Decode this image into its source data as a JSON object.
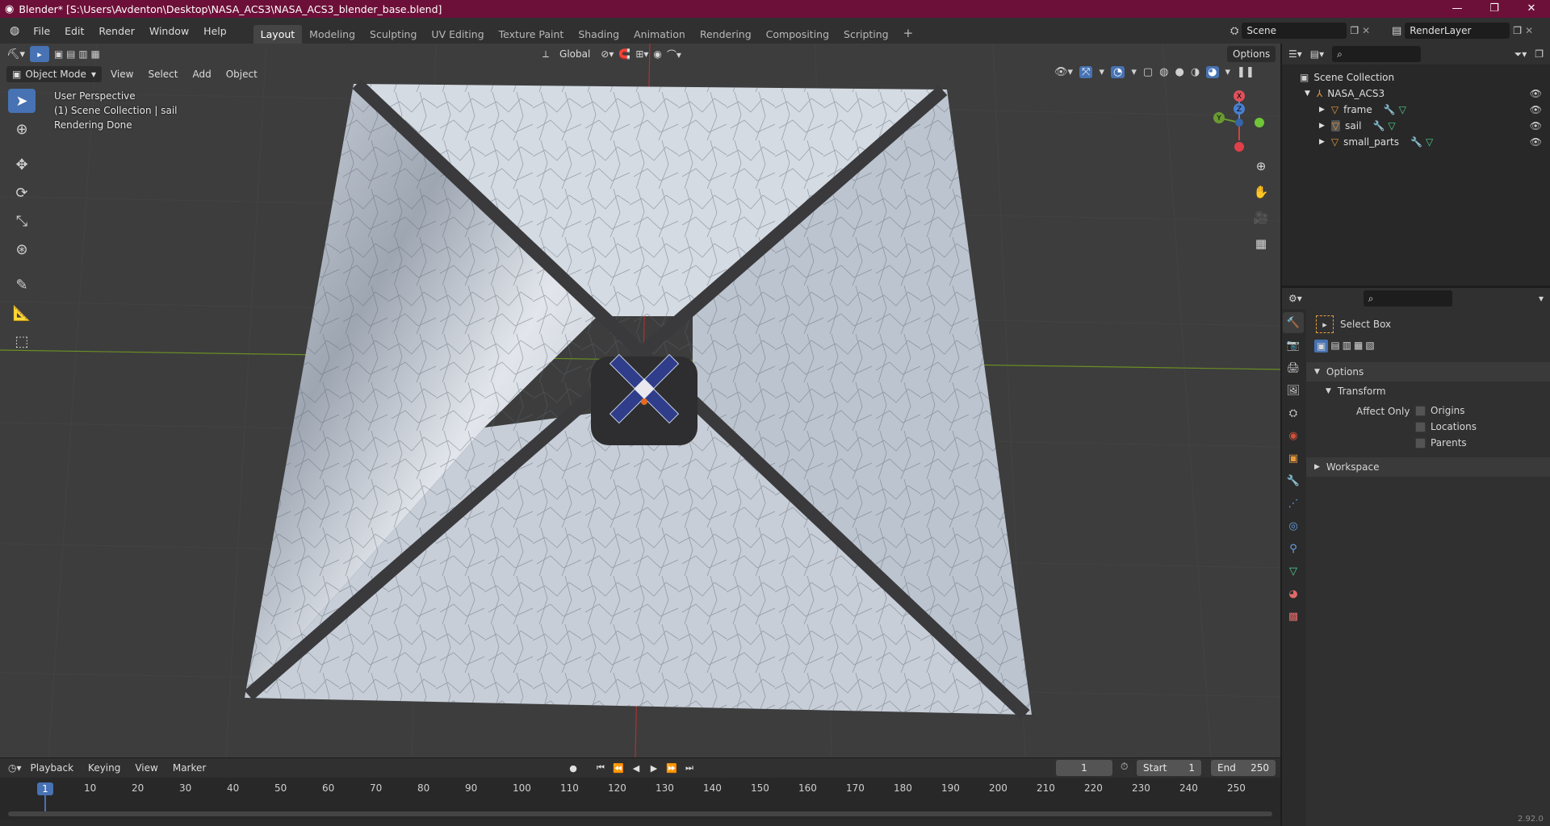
{
  "window": {
    "title": "Blender* [S:\\Users\\Avdenton\\Desktop\\NASA_ACS3\\NASA_ACS3_blender_base.blend]",
    "minimize": "—",
    "restore": "❐",
    "close": "✕"
  },
  "menu": [
    "File",
    "Edit",
    "Render",
    "Window",
    "Help"
  ],
  "workspaces": [
    {
      "label": "Layout",
      "active": true
    },
    {
      "label": "Modeling"
    },
    {
      "label": "Sculpting"
    },
    {
      "label": "UV Editing"
    },
    {
      "label": "Texture Paint"
    },
    {
      "label": "Shading"
    },
    {
      "label": "Animation"
    },
    {
      "label": "Rendering"
    },
    {
      "label": "Compositing"
    },
    {
      "label": "Scripting"
    }
  ],
  "scene": {
    "name": "Scene",
    "render_layer": "RenderLayer"
  },
  "viewport": {
    "mode": "Object Mode",
    "header_menu": [
      "View",
      "Select",
      "Add",
      "Object"
    ],
    "transform_orientation": "Global",
    "options_label": "Options",
    "overlay": {
      "perspective": "User Perspective",
      "collection": "(1) Scene Collection | sail",
      "status": "Rendering Done"
    },
    "gizmo": {
      "x": "X",
      "y": "Y",
      "z": "Z"
    }
  },
  "outliner": {
    "root": "Scene Collection",
    "collection": "NASA_ACS3",
    "objects": [
      {
        "name": "frame"
      },
      {
        "name": "sail"
      },
      {
        "name": "small_parts"
      }
    ]
  },
  "properties": {
    "tool_name": "Select Box",
    "options_header": "Options",
    "transform_header": "Transform",
    "affect_only_label": "Affect Only",
    "checkboxes": [
      "Origins",
      "Locations",
      "Parents"
    ],
    "workspace_header": "Workspace"
  },
  "timeline": {
    "menu": [
      "Playback",
      "Keying",
      "View",
      "Marker"
    ],
    "current_frame": "1",
    "start_label": "Start",
    "start": "1",
    "end_label": "End",
    "end": "250",
    "ticks": [
      "10",
      "20",
      "30",
      "40",
      "50",
      "60",
      "70",
      "80",
      "90",
      "100",
      "110",
      "120",
      "130",
      "140",
      "150",
      "160",
      "170",
      "180",
      "190",
      "200",
      "210",
      "220",
      "230",
      "240",
      "250"
    ],
    "playhead": "1"
  },
  "status_bar": {
    "version": "2.92.0"
  }
}
